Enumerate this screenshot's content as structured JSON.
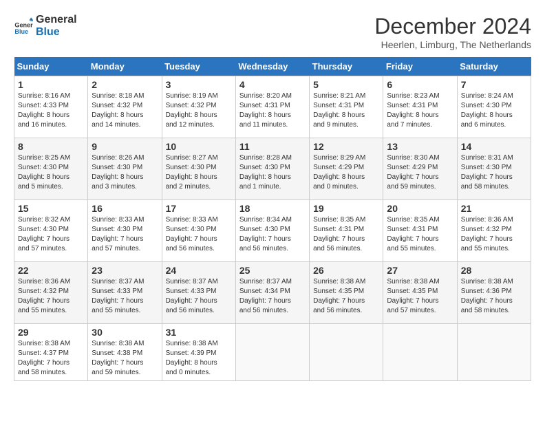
{
  "header": {
    "logo_line1": "General",
    "logo_line2": "Blue",
    "month_title": "December 2024",
    "location": "Heerlen, Limburg, The Netherlands"
  },
  "weekdays": [
    "Sunday",
    "Monday",
    "Tuesday",
    "Wednesday",
    "Thursday",
    "Friday",
    "Saturday"
  ],
  "weeks": [
    [
      {
        "day": "1",
        "info": "Sunrise: 8:16 AM\nSunset: 4:33 PM\nDaylight: 8 hours\nand 16 minutes."
      },
      {
        "day": "2",
        "info": "Sunrise: 8:18 AM\nSunset: 4:32 PM\nDaylight: 8 hours\nand 14 minutes."
      },
      {
        "day": "3",
        "info": "Sunrise: 8:19 AM\nSunset: 4:32 PM\nDaylight: 8 hours\nand 12 minutes."
      },
      {
        "day": "4",
        "info": "Sunrise: 8:20 AM\nSunset: 4:31 PM\nDaylight: 8 hours\nand 11 minutes."
      },
      {
        "day": "5",
        "info": "Sunrise: 8:21 AM\nSunset: 4:31 PM\nDaylight: 8 hours\nand 9 minutes."
      },
      {
        "day": "6",
        "info": "Sunrise: 8:23 AM\nSunset: 4:31 PM\nDaylight: 8 hours\nand 7 minutes."
      },
      {
        "day": "7",
        "info": "Sunrise: 8:24 AM\nSunset: 4:30 PM\nDaylight: 8 hours\nand 6 minutes."
      }
    ],
    [
      {
        "day": "8",
        "info": "Sunrise: 8:25 AM\nSunset: 4:30 PM\nDaylight: 8 hours\nand 5 minutes."
      },
      {
        "day": "9",
        "info": "Sunrise: 8:26 AM\nSunset: 4:30 PM\nDaylight: 8 hours\nand 3 minutes."
      },
      {
        "day": "10",
        "info": "Sunrise: 8:27 AM\nSunset: 4:30 PM\nDaylight: 8 hours\nand 2 minutes."
      },
      {
        "day": "11",
        "info": "Sunrise: 8:28 AM\nSunset: 4:30 PM\nDaylight: 8 hours\nand 1 minute."
      },
      {
        "day": "12",
        "info": "Sunrise: 8:29 AM\nSunset: 4:29 PM\nDaylight: 8 hours\nand 0 minutes."
      },
      {
        "day": "13",
        "info": "Sunrise: 8:30 AM\nSunset: 4:29 PM\nDaylight: 7 hours\nand 59 minutes."
      },
      {
        "day": "14",
        "info": "Sunrise: 8:31 AM\nSunset: 4:30 PM\nDaylight: 7 hours\nand 58 minutes."
      }
    ],
    [
      {
        "day": "15",
        "info": "Sunrise: 8:32 AM\nSunset: 4:30 PM\nDaylight: 7 hours\nand 57 minutes."
      },
      {
        "day": "16",
        "info": "Sunrise: 8:33 AM\nSunset: 4:30 PM\nDaylight: 7 hours\nand 57 minutes."
      },
      {
        "day": "17",
        "info": "Sunrise: 8:33 AM\nSunset: 4:30 PM\nDaylight: 7 hours\nand 56 minutes."
      },
      {
        "day": "18",
        "info": "Sunrise: 8:34 AM\nSunset: 4:30 PM\nDaylight: 7 hours\nand 56 minutes."
      },
      {
        "day": "19",
        "info": "Sunrise: 8:35 AM\nSunset: 4:31 PM\nDaylight: 7 hours\nand 56 minutes."
      },
      {
        "day": "20",
        "info": "Sunrise: 8:35 AM\nSunset: 4:31 PM\nDaylight: 7 hours\nand 55 minutes."
      },
      {
        "day": "21",
        "info": "Sunrise: 8:36 AM\nSunset: 4:32 PM\nDaylight: 7 hours\nand 55 minutes."
      }
    ],
    [
      {
        "day": "22",
        "info": "Sunrise: 8:36 AM\nSunset: 4:32 PM\nDaylight: 7 hours\nand 55 minutes."
      },
      {
        "day": "23",
        "info": "Sunrise: 8:37 AM\nSunset: 4:33 PM\nDaylight: 7 hours\nand 55 minutes."
      },
      {
        "day": "24",
        "info": "Sunrise: 8:37 AM\nSunset: 4:33 PM\nDaylight: 7 hours\nand 56 minutes."
      },
      {
        "day": "25",
        "info": "Sunrise: 8:37 AM\nSunset: 4:34 PM\nDaylight: 7 hours\nand 56 minutes."
      },
      {
        "day": "26",
        "info": "Sunrise: 8:38 AM\nSunset: 4:35 PM\nDaylight: 7 hours\nand 56 minutes."
      },
      {
        "day": "27",
        "info": "Sunrise: 8:38 AM\nSunset: 4:35 PM\nDaylight: 7 hours\nand 57 minutes."
      },
      {
        "day": "28",
        "info": "Sunrise: 8:38 AM\nSunset: 4:36 PM\nDaylight: 7 hours\nand 58 minutes."
      }
    ],
    [
      {
        "day": "29",
        "info": "Sunrise: 8:38 AM\nSunset: 4:37 PM\nDaylight: 7 hours\nand 58 minutes."
      },
      {
        "day": "30",
        "info": "Sunrise: 8:38 AM\nSunset: 4:38 PM\nDaylight: 7 hours\nand 59 minutes."
      },
      {
        "day": "31",
        "info": "Sunrise: 8:38 AM\nSunset: 4:39 PM\nDaylight: 8 hours\nand 0 minutes."
      },
      {
        "day": "",
        "info": ""
      },
      {
        "day": "",
        "info": ""
      },
      {
        "day": "",
        "info": ""
      },
      {
        "day": "",
        "info": ""
      }
    ]
  ]
}
